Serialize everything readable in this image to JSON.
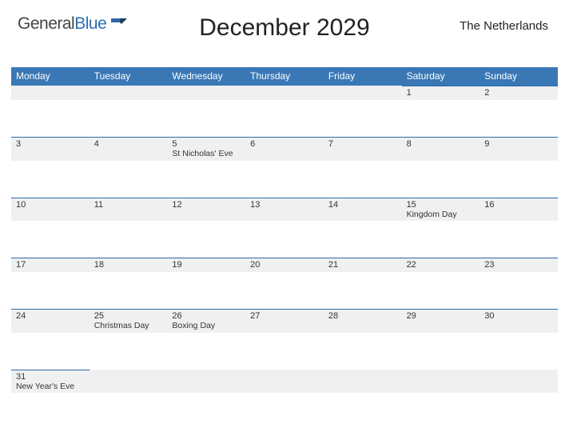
{
  "brand": {
    "general": "General",
    "blue": "Blue"
  },
  "title": "December 2029",
  "region": "The Netherlands",
  "day_headers": [
    "Monday",
    "Tuesday",
    "Wednesday",
    "Thursday",
    "Friday",
    "Saturday",
    "Sunday"
  ],
  "weeks": [
    [
      {
        "n": "",
        "h": ""
      },
      {
        "n": "",
        "h": ""
      },
      {
        "n": "",
        "h": ""
      },
      {
        "n": "",
        "h": ""
      },
      {
        "n": "",
        "h": ""
      },
      {
        "n": "1",
        "h": ""
      },
      {
        "n": "2",
        "h": ""
      }
    ],
    [
      {
        "n": "3",
        "h": ""
      },
      {
        "n": "4",
        "h": ""
      },
      {
        "n": "5",
        "h": "St Nicholas' Eve"
      },
      {
        "n": "6",
        "h": ""
      },
      {
        "n": "7",
        "h": ""
      },
      {
        "n": "8",
        "h": ""
      },
      {
        "n": "9",
        "h": ""
      }
    ],
    [
      {
        "n": "10",
        "h": ""
      },
      {
        "n": "11",
        "h": ""
      },
      {
        "n": "12",
        "h": ""
      },
      {
        "n": "13",
        "h": ""
      },
      {
        "n": "14",
        "h": ""
      },
      {
        "n": "15",
        "h": "Kingdom Day"
      },
      {
        "n": "16",
        "h": ""
      }
    ],
    [
      {
        "n": "17",
        "h": ""
      },
      {
        "n": "18",
        "h": ""
      },
      {
        "n": "19",
        "h": ""
      },
      {
        "n": "20",
        "h": ""
      },
      {
        "n": "21",
        "h": ""
      },
      {
        "n": "22",
        "h": ""
      },
      {
        "n": "23",
        "h": ""
      }
    ],
    [
      {
        "n": "24",
        "h": ""
      },
      {
        "n": "25",
        "h": "Christmas Day"
      },
      {
        "n": "26",
        "h": "Boxing Day"
      },
      {
        "n": "27",
        "h": ""
      },
      {
        "n": "28",
        "h": ""
      },
      {
        "n": "29",
        "h": ""
      },
      {
        "n": "30",
        "h": ""
      }
    ],
    [
      {
        "n": "31",
        "h": "New Year's Eve"
      },
      {
        "n": "",
        "h": ""
      },
      {
        "n": "",
        "h": ""
      },
      {
        "n": "",
        "h": ""
      },
      {
        "n": "",
        "h": ""
      },
      {
        "n": "",
        "h": ""
      },
      {
        "n": "",
        "h": ""
      }
    ]
  ]
}
